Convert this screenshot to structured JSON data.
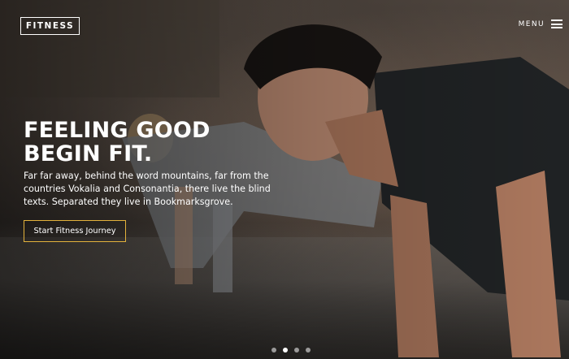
{
  "header": {
    "logo_text": "FITNESS",
    "menu_label": "MENU"
  },
  "hero": {
    "headline_line1": "FEELING GOOD",
    "headline_line2": "BEGIN FIT.",
    "description": "Far far away, behind the word mountains, far from the countries Vokalia and Consonantia, there live the blind texts. Separated they live in Bookmarksgrove.",
    "cta_label": "Start Fitness Journey"
  },
  "carousel": {
    "dot_count": 4,
    "active_index": 1
  },
  "colors": {
    "cta_border": "#e3b23c",
    "text": "#ffffff"
  },
  "icons": [
    "hamburger-menu-icon"
  ]
}
